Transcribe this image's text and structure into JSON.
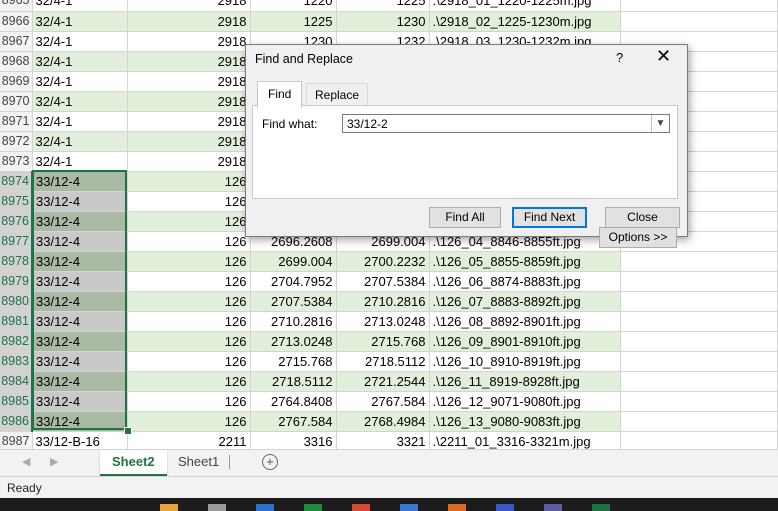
{
  "rows": [
    {
      "num": "8965",
      "a": "32/4-1",
      "b": "2918",
      "c": "1220",
      "d": "1225",
      "e": ".\\2918_01_1220-1225m.jpg",
      "band": false
    },
    {
      "num": "8966",
      "a": "32/4-1",
      "b": "2918",
      "c": "1225",
      "d": "1230",
      "e": ".\\2918_02_1225-1230m.jpg",
      "band": true
    },
    {
      "num": "8967",
      "a": "32/4-1",
      "b": "2918",
      "c": "1230",
      "d": "1232",
      "e": ".\\2918_03_1230-1232m.jpg",
      "band": false
    },
    {
      "num": "8968",
      "a": "32/4-1",
      "b": "2918",
      "c": "",
      "d": "",
      "e": "",
      "band": true
    },
    {
      "num": "8969",
      "a": "32/4-1",
      "b": "2918",
      "c": "",
      "d": "",
      "e": "",
      "band": false
    },
    {
      "num": "8970",
      "a": "32/4-1",
      "b": "2918",
      "c": "",
      "d": "",
      "e": "",
      "band": true
    },
    {
      "num": "8971",
      "a": "32/4-1",
      "b": "2918",
      "c": "",
      "d": "",
      "e": "",
      "band": false
    },
    {
      "num": "8972",
      "a": "32/4-1",
      "b": "2918",
      "c": "",
      "d": "",
      "e": "",
      "band": true
    },
    {
      "num": "8973",
      "a": "32/4-1",
      "b": "2918",
      "c": "",
      "d": "",
      "e": "",
      "band": false
    },
    {
      "num": "8974",
      "a": "33/12-4",
      "b": "126",
      "c": "",
      "d": "",
      "e": "",
      "band": true,
      "sel": true
    },
    {
      "num": "8975",
      "a": "33/12-4",
      "b": "126",
      "c": "",
      "d": "",
      "e": "",
      "band": false,
      "sel": true
    },
    {
      "num": "8976",
      "a": "33/12-4",
      "b": "126",
      "c": "",
      "d": "",
      "e": "",
      "band": true,
      "sel": true
    },
    {
      "num": "8977",
      "a": "33/12-4",
      "b": "126",
      "c": "2696.2608",
      "d": "2699.004",
      "e": ".\\126_04_8846-8855ft.jpg",
      "band": false,
      "sel": true
    },
    {
      "num": "8978",
      "a": "33/12-4",
      "b": "126",
      "c": "2699.004",
      "d": "2700.2232",
      "e": ".\\126_05_8855-8859ft.jpg",
      "band": true,
      "sel": true
    },
    {
      "num": "8979",
      "a": "33/12-4",
      "b": "126",
      "c": "2704.7952",
      "d": "2707.5384",
      "e": ".\\126_06_8874-8883ft.jpg",
      "band": false,
      "sel": true
    },
    {
      "num": "8980",
      "a": "33/12-4",
      "b": "126",
      "c": "2707.5384",
      "d": "2710.2816",
      "e": ".\\126_07_8883-8892ft.jpg",
      "band": true,
      "sel": true
    },
    {
      "num": "8981",
      "a": "33/12-4",
      "b": "126",
      "c": "2710.2816",
      "d": "2713.0248",
      "e": ".\\126_08_8892-8901ft.jpg",
      "band": false,
      "sel": true
    },
    {
      "num": "8982",
      "a": "33/12-4",
      "b": "126",
      "c": "2713.0248",
      "d": "2715.768",
      "e": ".\\126_09_8901-8910ft.jpg",
      "band": true,
      "sel": true
    },
    {
      "num": "8983",
      "a": "33/12-4",
      "b": "126",
      "c": "2715.768",
      "d": "2718.5112",
      "e": ".\\126_10_8910-8919ft.jpg",
      "band": false,
      "sel": true
    },
    {
      "num": "8984",
      "a": "33/12-4",
      "b": "126",
      "c": "2718.5112",
      "d": "2721.2544",
      "e": ".\\126_11_8919-8928ft.jpg",
      "band": true,
      "sel": true
    },
    {
      "num": "8985",
      "a": "33/12-4",
      "b": "126",
      "c": "2764.8408",
      "d": "2767.584",
      "e": ".\\126_12_9071-9080ft.jpg",
      "band": false,
      "sel": true
    },
    {
      "num": "8986",
      "a": "33/12-4",
      "b": "126",
      "c": "2767.584",
      "d": "2768.4984",
      "e": ".\\126_13_9080-9083ft.jpg",
      "band": true,
      "sel": true
    },
    {
      "num": "8987",
      "a": "33/12-B-16",
      "b": "2211",
      "c": "3316",
      "d": "3321",
      "e": ".\\2211_01_3316-3321m.jpg",
      "band": false
    }
  ],
  "sheet_tabs": {
    "active": "Sheet2",
    "other": "Sheet1",
    "add": "+"
  },
  "status": {
    "text": "Ready"
  },
  "dialog": {
    "title": "Find and Replace",
    "help": "?",
    "close": "✕",
    "tab_find": "Find",
    "tab_replace": "Replace",
    "find_what_label": "Find what:",
    "find_what_value": "33/12-2",
    "options_button": "Options >>",
    "find_all_button": "Find All",
    "find_next_button": "Find Next",
    "close_button": "Close"
  },
  "colors": {
    "accent": "#217346",
    "band": "#e2efda",
    "focus": "#0078d7"
  }
}
